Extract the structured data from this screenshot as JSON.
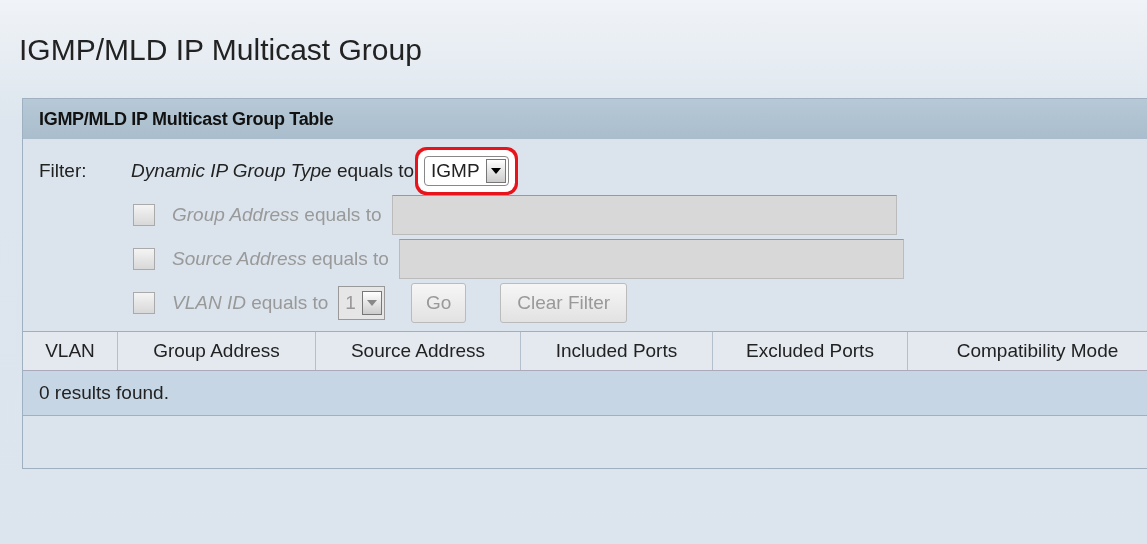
{
  "page_title": "IGMP/MLD IP Multicast Group",
  "panel": {
    "title": "IGMP/MLD IP Multicast Group Table",
    "filter_label": "Filter:",
    "type_filter": {
      "label": "*Dynamic IP Group Type* equals to",
      "value": "IGMP",
      "highlighted": true
    },
    "conditions": [
      {
        "kind": "text",
        "label": "*Group Address* equals to",
        "checked": false,
        "disabled": true
      },
      {
        "kind": "text",
        "label": "*Source Address* equals to",
        "checked": false,
        "disabled": true
      },
      {
        "kind": "select",
        "label": "*VLAN ID* equals to",
        "value": "1",
        "checked": false,
        "disabled": true
      }
    ],
    "buttons": [
      {
        "label": "Go",
        "disabled": true
      },
      {
        "label": "Clear Filter",
        "disabled": true
      }
    ],
    "columns": [
      "VLAN",
      "Group Address",
      "Source Address",
      "Included Ports",
      "Excluded Ports",
      "Compatibility Mode"
    ],
    "message": "0 results found."
  }
}
